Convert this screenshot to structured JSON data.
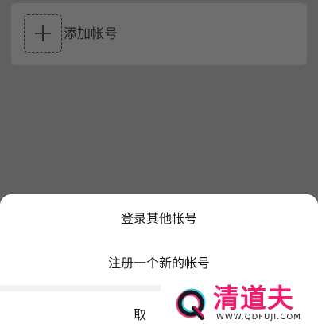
{
  "account_list": {
    "add_account_label": "添加帐号",
    "add_icon": "plus-icon"
  },
  "action_sheet": {
    "login_other_label": "登录其他帐号",
    "register_new_label": "注册一个新的帐号",
    "cancel_label": "取"
  },
  "watermark": {
    "title": "清道夫",
    "url": "WWW.QDFUJI.COM",
    "logo_icon": "q-logo-icon",
    "colors": {
      "brand_pink": "#f21b6e",
      "brand_cyan": "#18c7e6",
      "brand_dark": "#1a1a1a"
    }
  },
  "colors": {
    "overlay": "#606060",
    "card": "#6e6e6e",
    "sheet": "#ffffff"
  }
}
